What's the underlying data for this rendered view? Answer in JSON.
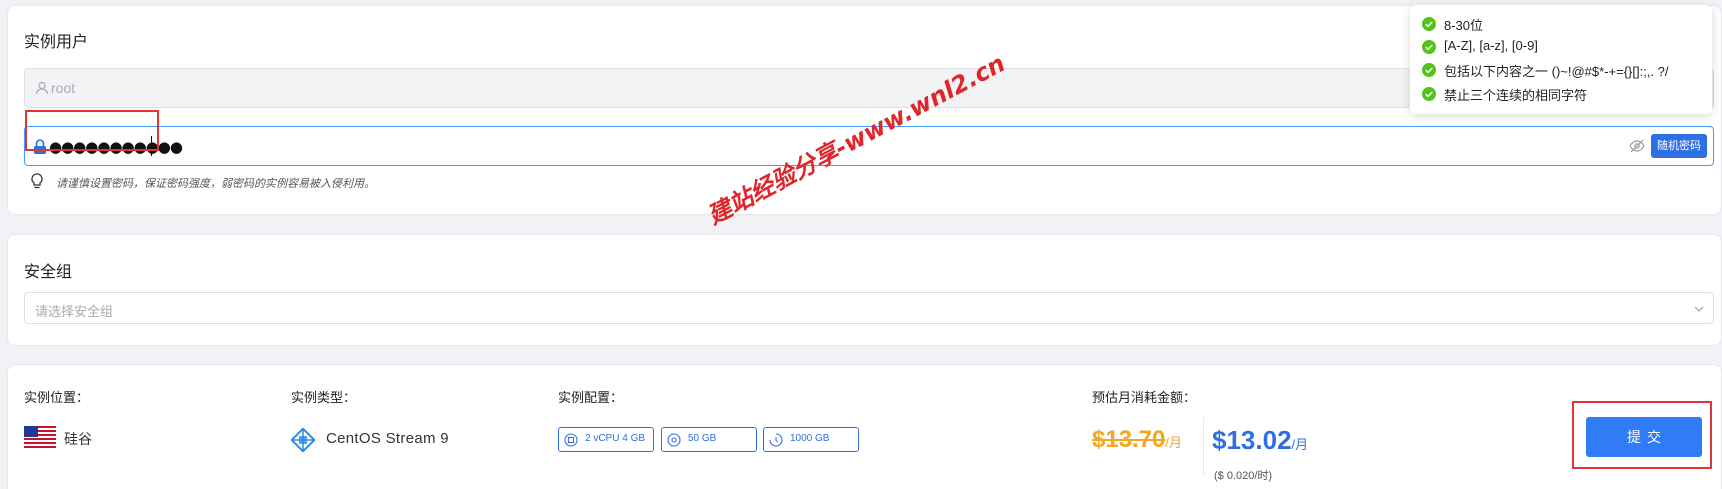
{
  "instance_user": {
    "title": "实例用户",
    "username": "root",
    "password_masked": "●●●●●●●●●●●",
    "random_password_label": "随机密码",
    "hint": "请谨慎设置密码，保证密码强度，弱密码的实例容易被入侵利用。"
  },
  "password_rules": [
    "8-30位",
    "[A-Z], [a-z], [0-9]",
    "包括以下内容之一 ()~!@#$*-+={}[]:;,. ?/",
    "禁止三个连续的相同字符"
  ],
  "security_group": {
    "title": "安全组",
    "placeholder": "请选择安全组"
  },
  "watermark": "建站经验分享-www.wnl2.cn",
  "summary": {
    "location_label": "实例位置：",
    "location_value": "硅谷",
    "type_label": "实例类型：",
    "type_value": "CentOS Stream 9",
    "config_label": "实例配置：",
    "specs": [
      {
        "icon": "cpu-icon",
        "text": "2 vCPU 4 GB"
      },
      {
        "icon": "disk-icon",
        "text": "50 GB"
      },
      {
        "icon": "bandwidth-icon",
        "text": "1000 GB"
      }
    ],
    "cost_label": "预估月消耗金额：",
    "old_price": "$13.70",
    "new_price": "$13.02",
    "price_unit": "/月",
    "hourly": "($ 0.020/时)",
    "submit_label": "提交"
  },
  "colors": {
    "accent": "#2f6fe4",
    "success": "#52c41a",
    "old_price": "#f5a623",
    "highlight": "#e03535"
  }
}
